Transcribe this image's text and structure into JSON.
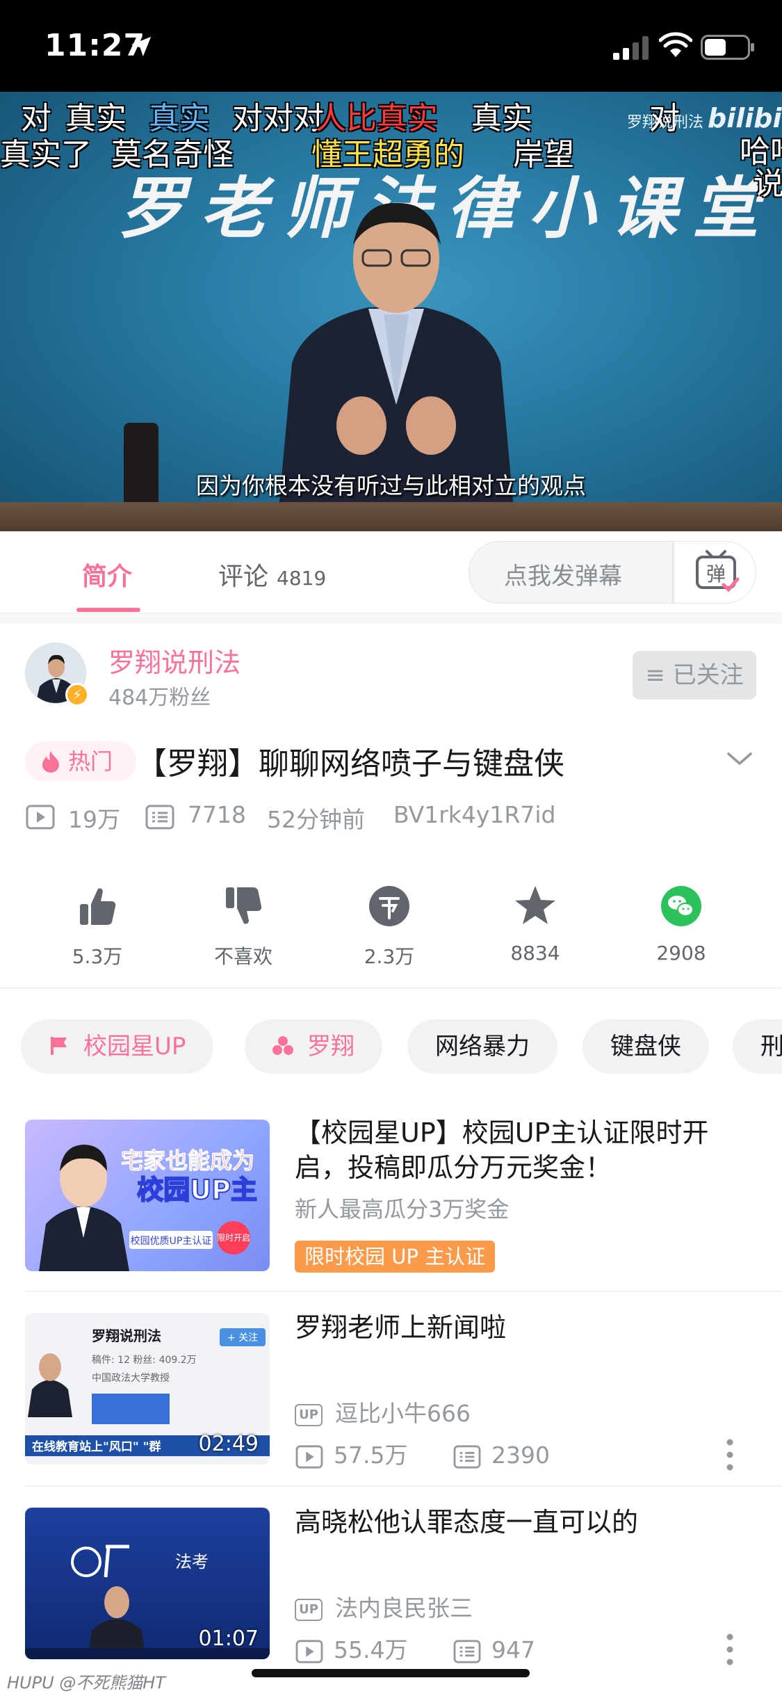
{
  "status_bar": {
    "time": "11:27"
  },
  "video": {
    "backdrop_title": "罗老师法律小课堂",
    "watermark": "罗翔说刑法",
    "watermark_logo": "bilibili",
    "subtitle": "因为你根本没有听过与此相对立的观点",
    "danmaku": [
      "对",
      "真实",
      "真实",
      "对对对",
      "人比真实",
      "真实",
      "对",
      "真实了",
      "莫名奇怪",
      "懂王超勇的",
      "岸望",
      "哈哈",
      "说"
    ]
  },
  "tabs": {
    "intro_label": "简介",
    "comments_label": "评论",
    "comments_count": "4819",
    "danmaku_placeholder": "点我发弹幕",
    "danmaku_btn_glyph": "弹"
  },
  "uploader": {
    "name": "罗翔说刑法",
    "fans": "484万粉丝",
    "follow_label": "≡ 已关注",
    "badge_glyph": "⚡"
  },
  "title": {
    "hot_label": "热门",
    "text": "【罗翔】聊聊网络喷子与键盘侠"
  },
  "meta": {
    "views": "19万",
    "danmaku_count": "7718",
    "time_ago": "52分钟前",
    "bvid": "BV1rk4y1R7id"
  },
  "actions": [
    {
      "name": "like",
      "label": "5.3万"
    },
    {
      "name": "dislike",
      "label": "不喜欢"
    },
    {
      "name": "coin",
      "label": "2.3万"
    },
    {
      "name": "favorite",
      "label": "8834"
    },
    {
      "name": "share",
      "label": "2908"
    }
  ],
  "tags": [
    "校园星UP",
    "罗翔",
    "网络暴力",
    "键盘侠",
    "刑"
  ],
  "related": [
    {
      "title": "【校园星UP】校园UP主认证限时开启，投稿即瓜分万元奖金！",
      "subtitle": "新人最高瓜分3万奖金",
      "badge": "限时校园 UP 主认证",
      "thumb_text_1": "宅家也能成为",
      "thumb_text_2": "校园UP主",
      "thumb_tag": "校园优质UP主认证",
      "thumb_limited": "限时开启"
    },
    {
      "title": "罗翔老师上新闻啦",
      "owner_badge": "UP",
      "owner": "逗比小牛666",
      "views": "57.5万",
      "danmaku": "2390",
      "duration": "02:49",
      "thumb_name": "罗翔说刑法",
      "thumb_follow": "+ 关注",
      "thumb_stats": "稿件: 12  粉丝: 409.2万",
      "thumb_school": "中国政法大学教授",
      "thumb_banner": "在线教育站上\"风口\" \"群"
    },
    {
      "title": "高晓松他认罪态度一直可以的",
      "owner_badge": "UP",
      "owner": "法内良民张三",
      "views": "55.4万",
      "danmaku": "947",
      "duration": "01:07",
      "thumb_brand": "法考"
    }
  ],
  "footer_mark": "HUPU @不死熊猫HT",
  "colors": {
    "accent": "#fb7299",
    "share": "#2bc15b",
    "orange": "#fa9a4b"
  }
}
